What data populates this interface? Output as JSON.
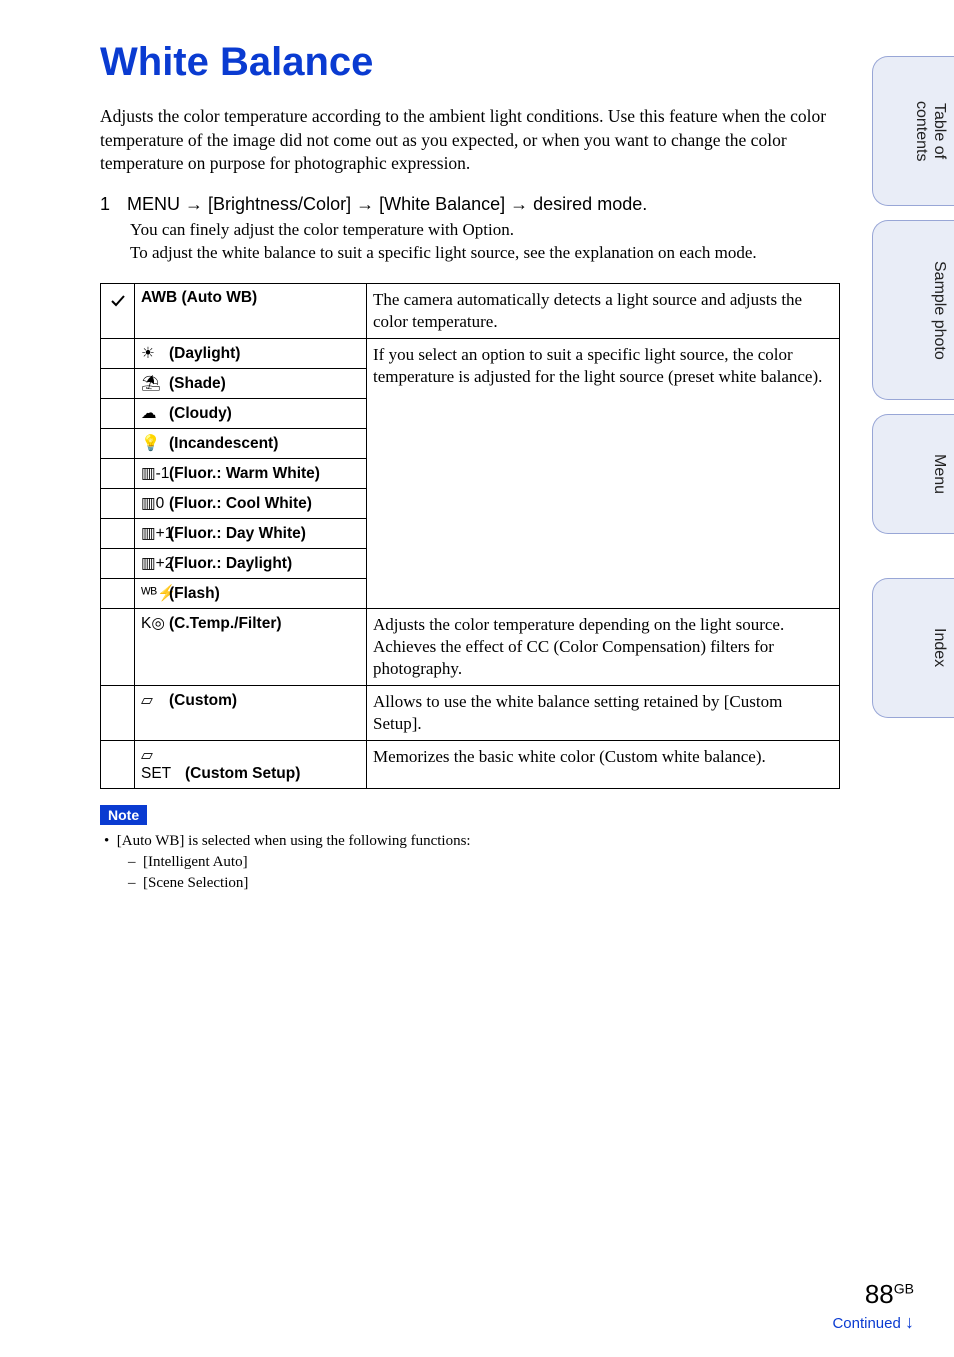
{
  "title": "White Balance",
  "intro": "Adjusts the color temperature according to the ambient light conditions.\nUse this feature when the color temperature of the image did not come out as you expected, or when you want to change the color temperature on purpose for photographic expression.",
  "step": {
    "number": "1",
    "text_prefix": "MENU ",
    "arrow": "→",
    "seg1": " [Brightness/Color] ",
    "seg2": " [White Balance] ",
    "seg3": " desired mode.",
    "sub1": "You can finely adjust the color temperature with Option.",
    "sub2": "To adjust the white balance to suit a specific light source, see the explanation on each mode."
  },
  "table": {
    "check_glyph": "✔",
    "rows": [
      {
        "icon": "",
        "label": "AWB (Auto WB)",
        "desc": "The camera automatically detects a light source and adjusts the color temperature."
      }
    ],
    "preset_group": {
      "desc": "If you select an option to suit a specific light source, the color temperature is adjusted for the light source (preset white balance).",
      "items": [
        {
          "icon": "☀",
          "label": "(Daylight)"
        },
        {
          "icon": "⛱",
          "label": "(Shade)"
        },
        {
          "icon": "☁",
          "label": "(Cloudy)"
        },
        {
          "icon": "💡",
          "label": "(Incandescent)"
        },
        {
          "icon": "▥-1",
          "label": "(Fluor.: Warm White)"
        },
        {
          "icon": "▥0",
          "label": "(Fluor.: Cool White)"
        },
        {
          "icon": "▥+1",
          "label": "(Fluor.: Day White)"
        },
        {
          "icon": "▥+2",
          "label": "(Fluor.: Daylight)"
        },
        {
          "icon": "ᵂᴮ⚡",
          "label": "(Flash)"
        }
      ]
    },
    "singles": [
      {
        "icon": "K◎",
        "label": "(C.Temp./Filter)",
        "desc": "Adjusts the color temperature depending on the light source. Achieves the effect of CC (Color Compensation) filters for photography."
      },
      {
        "icon": "▱",
        "label": "(Custom)",
        "desc": "Allows to use the white balance setting retained by [Custom Setup]."
      },
      {
        "icon": "▱ SET",
        "label": "(Custom Setup)",
        "desc": "Memorizes the basic white color (Custom white balance)."
      }
    ]
  },
  "note": {
    "badge": "Note",
    "lead": "[Auto WB] is selected when using the following functions:",
    "items": [
      "[Intelligent Auto]",
      "[Scene Selection]"
    ]
  },
  "side_tabs": {
    "toc": "Table of contents",
    "sample": "Sample photo",
    "menu": "Menu",
    "index": "Index"
  },
  "footer": {
    "page": "88",
    "gb": "GB",
    "continued": "Continued ",
    "arrow": "↓"
  }
}
